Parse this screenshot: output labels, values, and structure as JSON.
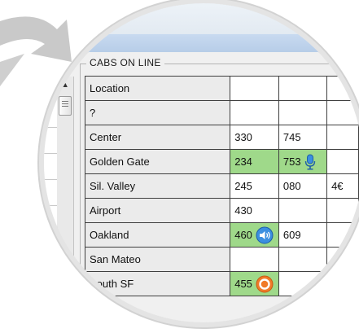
{
  "groupbox": {
    "title": "CABS ON LINE"
  },
  "grid": {
    "header": "Location",
    "rows": [
      {
        "location": "?",
        "c1": "",
        "c2": "",
        "c3": ""
      },
      {
        "location": "Center",
        "c1": "330",
        "c2": "745",
        "c3": ""
      },
      {
        "location": "Golden Gate",
        "c1": "234",
        "c2": "753",
        "c3": ""
      },
      {
        "location": "Sil. Valley",
        "c1": "245",
        "c2": "080",
        "c3": "4€"
      },
      {
        "location": "Airport",
        "c1": "430",
        "c2": "",
        "c3": ""
      },
      {
        "location": "Oakland",
        "c1": "460",
        "c2": "609",
        "c3": ""
      },
      {
        "location": "San Mateo",
        "c1": "",
        "c2": "",
        "c3": ""
      },
      {
        "location": "South SF",
        "c1": "455",
        "c2": "",
        "c3": ""
      }
    ]
  },
  "icons": {
    "golden_gate": "microphone-icon",
    "oakland": "speaker-icon",
    "south_sf": "ring-icon"
  },
  "colors": {
    "highlight": "#9fd98a",
    "selection": "#2a74c6",
    "icon_blue": "#3b8fe0",
    "icon_orange": "#f07a28"
  }
}
